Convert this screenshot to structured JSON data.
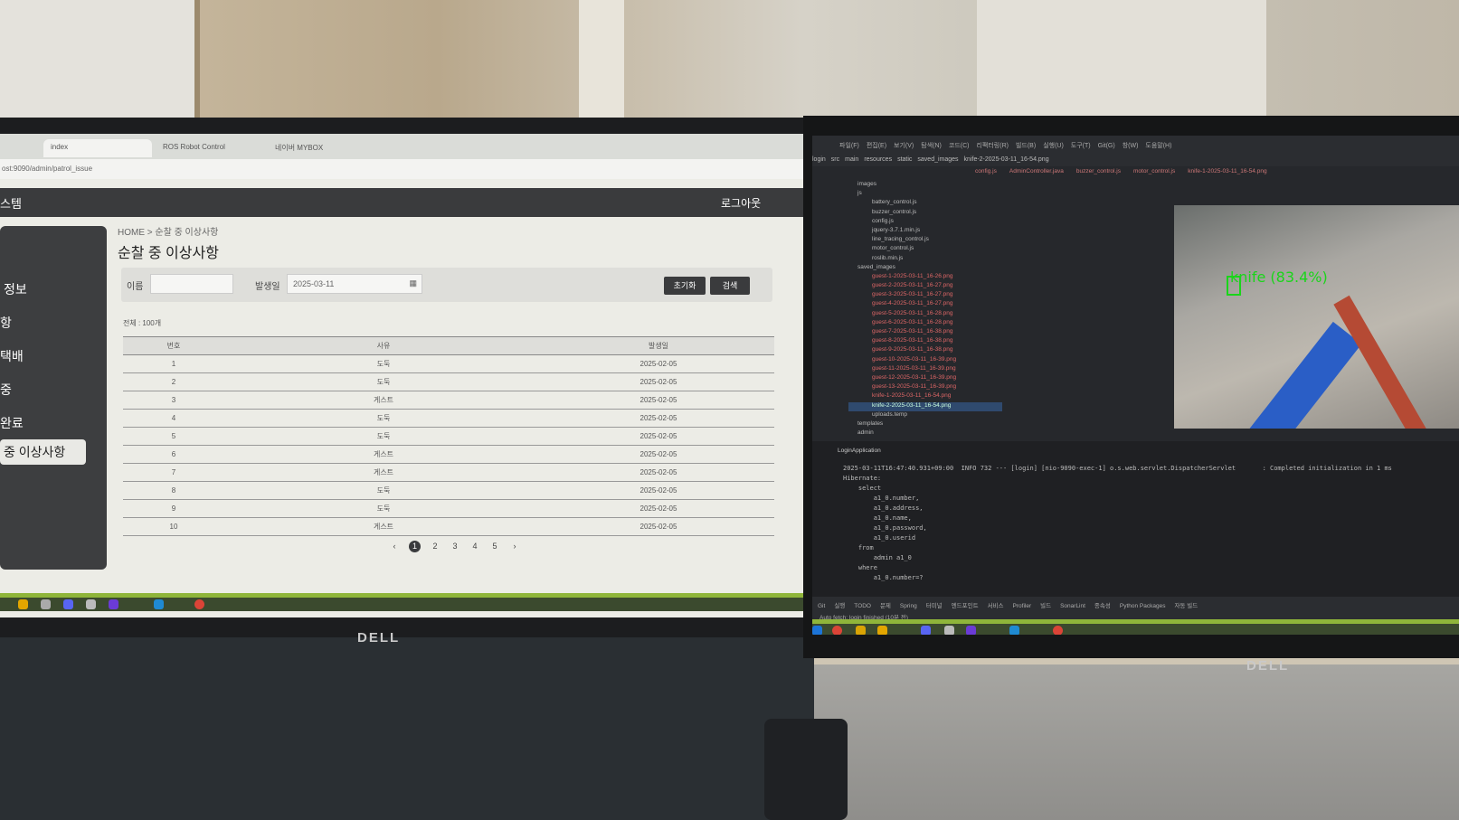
{
  "room": {
    "left_monitor_brand": "DELL",
    "right_monitor_brand": "DELL"
  },
  "left_browser": {
    "tabs": [
      "index",
      "ROS Robot Control",
      "네이버 MYBOX"
    ],
    "address": "ost:9090/admin/patrol_issue",
    "header": {
      "brand": "스템",
      "logout": "로그아웃"
    },
    "sidebar": [
      "정보",
      "항",
      "택배",
      "중",
      "완료",
      "중 이상사항"
    ],
    "breadcrumb": "HOME  >  순찰 중 이상사항",
    "page_title": "순찰 중 이상사항",
    "filter": {
      "name_label": "이름",
      "name_value": "",
      "date_label": "발생일",
      "date_value": "2025-03-11",
      "reset_label": "초기화",
      "search_label": "검색"
    },
    "total": "전체 : 100개",
    "table": {
      "headers": [
        "번호",
        "사유",
        "발생일"
      ],
      "rows": [
        [
          "1",
          "도둑",
          "2025-02-05"
        ],
        [
          "2",
          "도둑",
          "2025-02-05"
        ],
        [
          "3",
          "게스트",
          "2025-02-05"
        ],
        [
          "4",
          "도둑",
          "2025-02-05"
        ],
        [
          "5",
          "도둑",
          "2025-02-05"
        ],
        [
          "6",
          "게스트",
          "2025-02-05"
        ],
        [
          "7",
          "게스트",
          "2025-02-05"
        ],
        [
          "8",
          "도둑",
          "2025-02-05"
        ],
        [
          "9",
          "도둑",
          "2025-02-05"
        ],
        [
          "10",
          "게스트",
          "2025-02-05"
        ]
      ]
    },
    "pagination": {
      "prev": "‹",
      "pages": [
        "1",
        "2",
        "3",
        "4",
        "5"
      ],
      "current": "1",
      "next": "›"
    }
  },
  "right_ide": {
    "menu": [
      "파일(F)",
      "편집(E)",
      "보기(V)",
      "탐색(N)",
      "코드(C)",
      "리팩터링(R)",
      "빌드(B)",
      "실행(U)",
      "도구(T)",
      "Git(G)",
      "창(W)",
      "도움말(H)"
    ],
    "path": [
      "login",
      "src",
      "main",
      "resources",
      "static",
      "saved_images",
      "knife-2-2025-03-11_16-54.png"
    ],
    "editor_tabs": [
      "config.js",
      "AdminController.java",
      "buzzer_control.js",
      "motor_control.js",
      "knife-1-2025-03-11_16-54.png"
    ],
    "project_tree": [
      "images",
      "js",
      "battery_control.js",
      "buzzer_control.js",
      "config.js",
      "jquery-3.7.1.min.js",
      "line_tracing_control.js",
      "motor_control.js",
      "roslib.min.js",
      "saved_images",
      "guest-1-2025-03-11_16-26.png",
      "guest-2-2025-03-11_16-27.png",
      "guest-3-2025-03-11_16-27.png",
      "guest-4-2025-03-11_16-27.png",
      "guest-5-2025-03-11_16-28.png",
      "guest-6-2025-03-11_16-28.png",
      "guest-7-2025-03-11_16-38.png",
      "guest-8-2025-03-11_16-38.png",
      "guest-9-2025-03-11_16-38.png",
      "guest-10-2025-03-11_16-39.png",
      "guest-11-2025-03-11_16-39.png",
      "guest-12-2025-03-11_16-39.png",
      "guest-13-2025-03-11_16-39.png",
      "knife-1-2025-03-11_16-54.png",
      "knife-2-2025-03-11_16-54.png",
      "uploads.temp",
      "templates",
      "admin"
    ],
    "detection_label": "knife (83.4%)",
    "run_tab": "LoginApplication",
    "console": [
      "2025-03-11T16:47:40.931+09:00  INFO 732 --- [login] [nio-9090-exec-1] o.s.web.servlet.DispatcherServlet       : Completed initialization in 1 ms",
      "Hibernate:",
      "    select",
      "        a1_0.number,",
      "        a1_0.address,",
      "        a1_0.name,",
      "        a1_0.password,",
      "        a1_0.userid",
      "    from",
      "        admin a1_0",
      "    where",
      "        a1_0.number=?"
    ],
    "status_items": [
      "Git",
      "실행",
      "TODO",
      "문제",
      "Spring",
      "터미널",
      "엔드포인트",
      "서비스",
      "Profiler",
      "빌드",
      "SonarLint",
      "종속성",
      "Python Packages",
      "자동 빌드"
    ],
    "status_message": "Auto fetch: login finished (10분 전)"
  },
  "colors": {
    "detection": "#1ad51a",
    "header_dark": "#3a3b3d",
    "taskbar_green": "#8fb53a"
  }
}
